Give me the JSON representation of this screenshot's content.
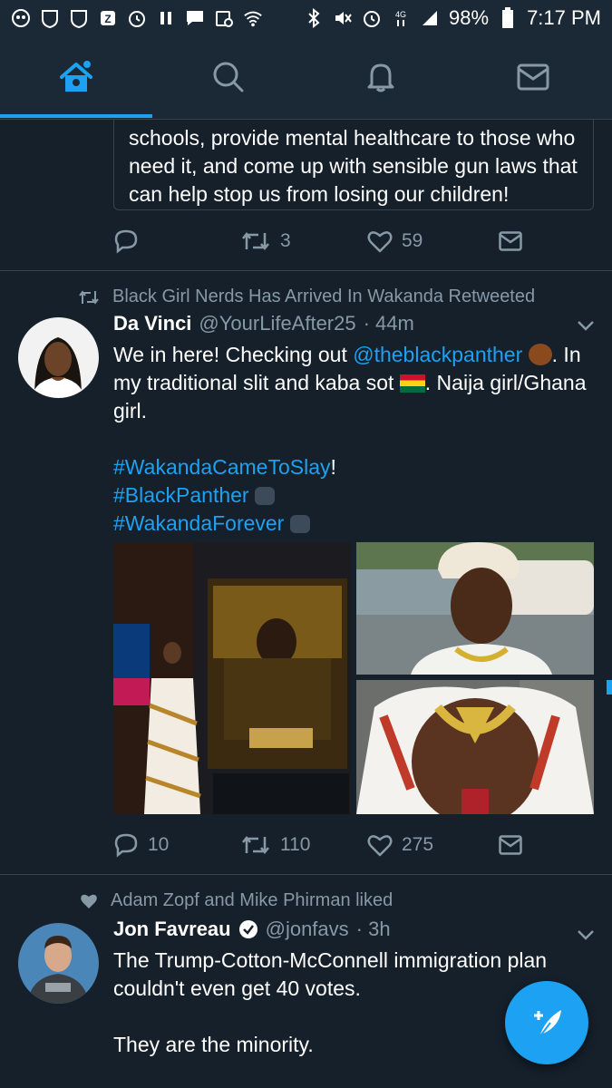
{
  "status_bar": {
    "battery": "98%",
    "time": "7:17 PM"
  },
  "nav": {
    "tabs": [
      {
        "name": "home",
        "icon": "home-icon",
        "active": true
      },
      {
        "name": "search",
        "icon": "search-icon",
        "active": false
      },
      {
        "name": "notifications",
        "icon": "bell-icon",
        "active": false
      },
      {
        "name": "messages",
        "icon": "mail-icon",
        "active": false
      }
    ]
  },
  "tweet0": {
    "text_lines": [
      "schools, provide mental healthcare to those who",
      "need it, and come up with sensible gun laws that",
      "can help stop us from losing our children!"
    ],
    "retweets": "3",
    "likes": "59"
  },
  "tweet1": {
    "context": "Black Girl Nerds Has Arrived In Wakanda Retweeted",
    "name": "Da Vinci",
    "handle": "@YourLifeAfter25",
    "time": "· 44m",
    "text_part1": "We in here! Checking out ",
    "mention": "@theblackpanther",
    "text_part2": ". In my traditional slit and kaba sot",
    "text_part3": ". Naija girl/Ghana girl.",
    "hashtags": [
      "#WakandaCameToSlay",
      "#BlackPanther",
      "#WakandaForever"
    ],
    "exclaim": "!",
    "replies": "10",
    "retweets": "110",
    "likes": "275"
  },
  "tweet2": {
    "context": "Adam Zopf and Mike Phirman liked",
    "name": "Jon Favreau",
    "handle": "@jonfavs",
    "time": "· 3h",
    "line1": "The Trump-Cotton-McConnell immigration plan",
    "line2": "couldn't even get 40 votes.",
    "line3": "They are the minority."
  },
  "colors": {
    "background": "#15202b",
    "accent": "#1da1f2",
    "muted": "#8899a6",
    "divider": "#38444d"
  }
}
